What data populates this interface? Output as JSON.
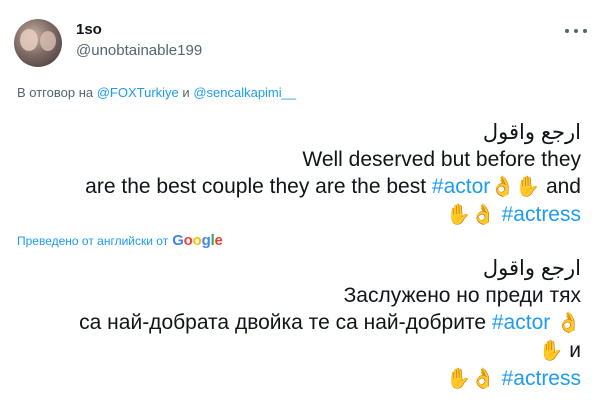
{
  "author": {
    "display_name": "1so",
    "handle": "@unobtainable199"
  },
  "reply": {
    "prefix": "В отговор на",
    "mention1": "@FOXTurkiye",
    "conjunction": "и",
    "mention2": "@sencalkapimi__"
  },
  "original": {
    "line1": "ارجع واقول",
    "line2": "Well deserved but before they",
    "line3_text": "are the best couple they are the best",
    "hashtag1": "#actor",
    "emoji_ok": "👌",
    "emoji_hand": "✋",
    "and": "and",
    "hashtag2": "#actress"
  },
  "translation": {
    "label": "Преведено от английски от",
    "brand": [
      "G",
      "o",
      "o",
      "g",
      "l",
      "e"
    ]
  },
  "translated": {
    "line1": "ارجع واقول",
    "line2": "Заслужено но преди тях",
    "line3_text": "са най-добрата двойка те са най-добрите",
    "hashtag1": "#actor",
    "emoji_ok": "👌",
    "emoji_hand": "✋",
    "and": "и",
    "hashtag2": "#actress"
  },
  "colors": {
    "link": "#1d9bf0",
    "secondary": "#536471",
    "text": "#0f1419"
  }
}
